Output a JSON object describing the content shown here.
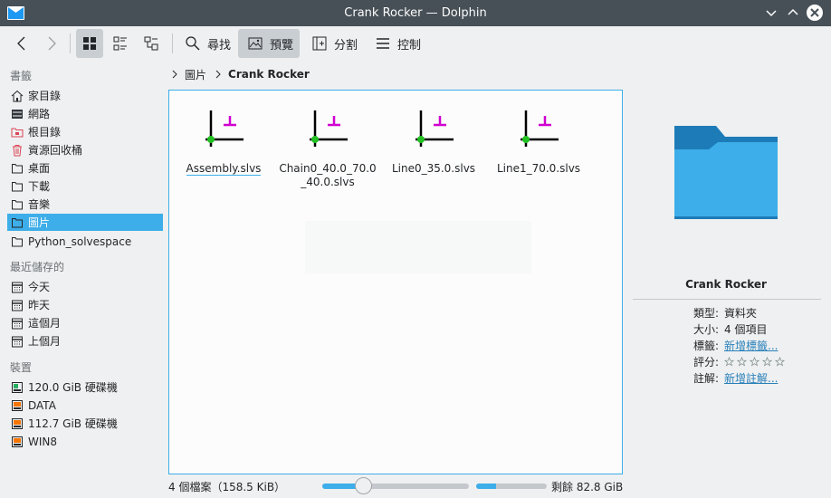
{
  "window": {
    "title": "Crank Rocker — Dolphin"
  },
  "toolbar": {
    "search_label": "尋找",
    "preview_label": "預覽",
    "split_label": "分割",
    "control_label": "控制"
  },
  "sidebar": {
    "bookmarks_heading": "書籤",
    "bookmarks": [
      {
        "label": "家目錄",
        "icon": "home-icon"
      },
      {
        "label": "網路",
        "icon": "network-icon"
      },
      {
        "label": "根目錄",
        "icon": "root-folder-icon"
      },
      {
        "label": "資源回收桶",
        "icon": "trash-icon"
      },
      {
        "label": "桌面",
        "icon": "folder-icon"
      },
      {
        "label": "下載",
        "icon": "folder-icon"
      },
      {
        "label": "音樂",
        "icon": "folder-icon"
      },
      {
        "label": "圖片",
        "icon": "folder-icon",
        "active": true
      },
      {
        "label": "Python_solvespace",
        "icon": "folder-icon"
      }
    ],
    "recent_heading": "最近儲存的",
    "recent": [
      {
        "label": "今天",
        "icon": "calendar-icon"
      },
      {
        "label": "昨天",
        "icon": "calendar-icon"
      },
      {
        "label": "這個月",
        "icon": "calendar-icon"
      },
      {
        "label": "上個月",
        "icon": "calendar-icon"
      }
    ],
    "devices_heading": "裝置",
    "devices": [
      {
        "label": "120.0 GiB 硬碟機",
        "icon": "drive-icon"
      },
      {
        "label": "DATA",
        "icon": "drive-icon"
      },
      {
        "label": "112.7 GiB 硬碟機",
        "icon": "drive-icon"
      },
      {
        "label": "WIN8",
        "icon": "drive-icon"
      }
    ]
  },
  "breadcrumb": {
    "parent": "圖片",
    "current": "Crank Rocker"
  },
  "files": [
    {
      "name": "Assembly.slvs"
    },
    {
      "name": "Chain0_40.0_70.0_40.0.slvs"
    },
    {
      "name": "Line0_35.0.slvs"
    },
    {
      "name": "Line1_70.0.slvs"
    }
  ],
  "info": {
    "name": "Crank Rocker",
    "type_key": "類型:",
    "type_val": "資料夾",
    "size_key": "大小:",
    "size_val": "4 個項目",
    "tags_key": "標籤:",
    "tags_val": "新增標籤...",
    "rating_key": "評分:",
    "rating_stars": 5,
    "rating_value": 0,
    "comment_key": "註解:",
    "comment_val": "新增註解..."
  },
  "status": {
    "summary": "4 個檔案（158.5 KiB）",
    "zoom_fraction": 0.28,
    "space_used_fraction": 0.28,
    "free_space": "剩餘 82.8 GiB"
  },
  "colors": {
    "accent": "#3daee9",
    "titlebar": "#475057",
    "folder": "#3daee9"
  }
}
